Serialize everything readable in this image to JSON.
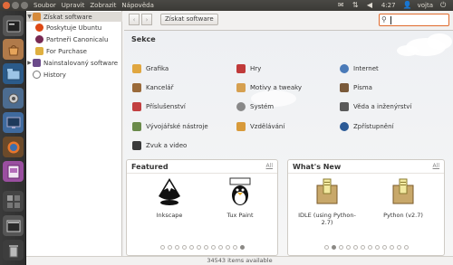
{
  "top_panel": {
    "menu": [
      "Soubor",
      "Upravit",
      "Zobrazit",
      "Nápověda"
    ],
    "time": "4:27",
    "user": "vojta"
  },
  "sidebar": {
    "items": [
      {
        "label": "Získat software",
        "expanded": true,
        "selected": true
      },
      {
        "label": "Poskytuje Ubuntu"
      },
      {
        "label": "Partneři Canonicalu"
      },
      {
        "label": "For Purchase"
      },
      {
        "label": "Nainstalovaný software",
        "expanded": false
      },
      {
        "label": "History"
      }
    ]
  },
  "toolbar": {
    "back": "‹",
    "forward": "›",
    "breadcrumb": "Získat software",
    "search_value": ""
  },
  "main": {
    "section_title": "Sekce",
    "categories": [
      {
        "label": "Grafika",
        "icon": "graphics-icon"
      },
      {
        "label": "Hry",
        "icon": "games-icon"
      },
      {
        "label": "Internet",
        "icon": "internet-icon"
      },
      {
        "label": "Kancelář",
        "icon": "office-icon"
      },
      {
        "label": "Motivy a tweaky",
        "icon": "themes-icon"
      },
      {
        "label": "Písma",
        "icon": "fonts-icon"
      },
      {
        "label": "Příslušenství",
        "icon": "accessories-icon"
      },
      {
        "label": "Systém",
        "icon": "system-icon"
      },
      {
        "label": "Věda a inženýrství",
        "icon": "science-icon"
      },
      {
        "label": "Vývojářské nástroje",
        "icon": "developer-tools-icon"
      },
      {
        "label": "Vzdělávání",
        "icon": "education-icon"
      },
      {
        "label": "Zpřístupnění",
        "icon": "accessibility-icon"
      },
      {
        "label": "Zvuk a video",
        "icon": "sound-video-icon"
      }
    ],
    "featured": {
      "title": "Featured",
      "all": "All",
      "apps": [
        {
          "name": "Inkscape",
          "icon": "inkscape-icon"
        },
        {
          "name": "Tux Paint",
          "icon": "tuxpaint-icon"
        }
      ],
      "dots": 12,
      "active_dot": 12
    },
    "whats_new": {
      "title": "What's New",
      "all": "All",
      "apps": [
        {
          "name": "IDLE (using Python-2.7)",
          "icon": "python-package-icon"
        },
        {
          "name": "Python (v2.7)",
          "icon": "python-package-icon"
        }
      ],
      "dots": 12,
      "active_dot": 2
    }
  },
  "status": "34543 items available",
  "colors": {
    "accent": "#e06a2c",
    "launcher": "#2e2e2e",
    "panel": "#3b3a36"
  }
}
